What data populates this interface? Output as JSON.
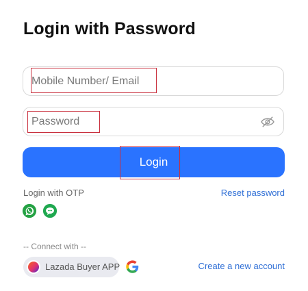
{
  "title": "Login with Password",
  "email_field": {
    "placeholder": "Mobile Number/ Email",
    "value": ""
  },
  "password_field": {
    "placeholder": "Password",
    "value": ""
  },
  "login_button": "Login",
  "otp": {
    "label": "Login with OTP",
    "methods": [
      {
        "name": "WhatsApp",
        "icon": "whatsapp-icon",
        "color": "#25a244"
      },
      {
        "name": "Message",
        "icon": "message-icon",
        "color": "#1fa84f"
      }
    ]
  },
  "reset_password": "Reset password",
  "connect_with": "-- Connect with --",
  "lazada_app": "Lazada Buyer APP",
  "create_account": "Create a new account",
  "colors": {
    "accent": "#2a73ff",
    "link": "#2f6fd6",
    "highlight": "#c9303e"
  }
}
